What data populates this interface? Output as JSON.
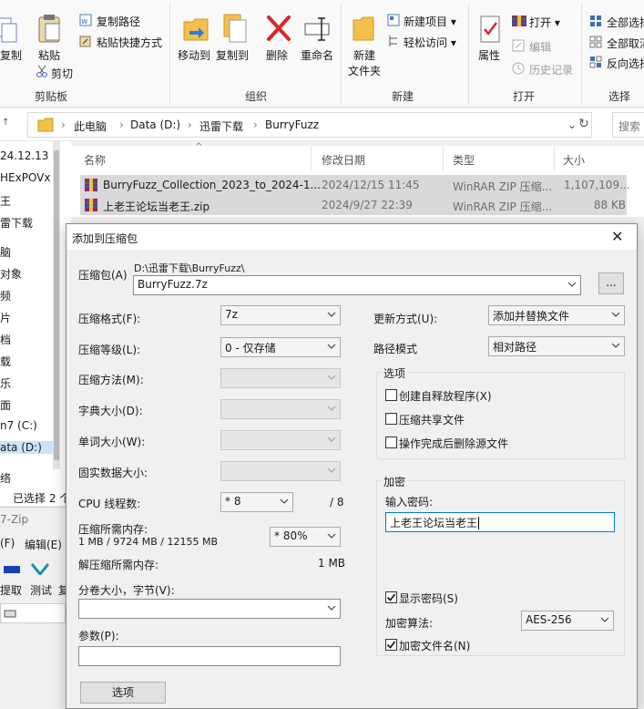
{
  "ribbon": {
    "clipboard": {
      "copy": "复制",
      "paste": "粘贴",
      "copy_path": "复制路径",
      "paste_shortcut": "粘贴快捷方式",
      "cut": "剪切",
      "group": "剪贴板"
    },
    "organize": {
      "move_to": "移动到",
      "copy_to": "复制到",
      "delete": "删除",
      "rename": "重命名",
      "group": "组织"
    },
    "new": {
      "new_folder_line1": "新建",
      "new_folder_line2": "文件夹",
      "new_item": "新建项目",
      "easy_access": "轻松访问",
      "group": "新建"
    },
    "open": {
      "properties": "属性",
      "open": "打开",
      "edit": "编辑",
      "history": "历史记录",
      "group": "打开"
    },
    "select": {
      "select_all": "全部选择",
      "select_none": "全部取消",
      "invert": "反向选择",
      "group": "选择"
    }
  },
  "address": {
    "crumbs": [
      "此电脑",
      "Data (D:)",
      "迅雷下载",
      "BurryFuzz"
    ],
    "search_placeholder": "搜索"
  },
  "columns": {
    "name": "名称",
    "date": "修改日期",
    "type": "类型",
    "size": "大小"
  },
  "files": [
    {
      "name": "BurryFuzz_Collection_2023_to_2024-1...",
      "date": "2024/12/15 11:45",
      "type": "WinRAR ZIP 压缩...",
      "size": "1,107,109..."
    },
    {
      "name": "上老王论坛当老王.zip",
      "date": "2024/9/27 22:39",
      "type": "WinRAR ZIP 压缩...",
      "size": "88 KB"
    }
  ],
  "nav_items": [
    "24.12.13",
    "HExPOVx",
    "王",
    "雷下载",
    "脑",
    "对象",
    "频",
    "片",
    "档",
    "载",
    "乐",
    "面",
    "n7 (C:)",
    "ata (D:)",
    "络"
  ],
  "status": {
    "selected": "已选择 2 个"
  },
  "sevenzip_bg": {
    "title": "7-Zip",
    "menu_file": "(F)",
    "menu_edit": "编辑(E)",
    "extract": "提取",
    "test": "测试",
    "copy": "复"
  },
  "dialog": {
    "title": "添加到压缩包",
    "archive_label": "压缩包(A)",
    "archive_path": "D:\\迅雷下载\\BurryFuzz\\",
    "archive_name": "BurryFuzz.7z",
    "browse": "...",
    "format_label": "压缩格式(F):",
    "format_value": "7z",
    "level_label": "压缩等级(L):",
    "level_value": "0 - 仅存储",
    "method_label": "压缩方法(M):",
    "dict_label": "字典大小(D):",
    "word_label": "单词大小(W):",
    "solid_label": "固实数据大小:",
    "threads_label": "CPU 线程数:",
    "threads_value": "8",
    "threads_max": "/ 8",
    "mem_label": "压缩所需内存:",
    "mem_detail": "1 MB / 9724 MB / 12155 MB",
    "mem_percent": "80%",
    "decomp_label": "解压缩所需内存:",
    "decomp_value": "1 MB",
    "split_label": "分卷大小，字节(V):",
    "params_label": "参数(P):",
    "options_button": "选项",
    "update_label": "更新方式(U):",
    "update_value": "添加并替换文件",
    "pathmode_label": "路径模式",
    "pathmode_value": "相对路径",
    "options_group": "选项",
    "opt_sfx": "创建自释放程序(X)",
    "opt_shared": "压缩共享文件",
    "opt_delete": "操作完成后删除源文件",
    "enc_group": "加密",
    "pwd_label": "输入密码:",
    "pwd_value": "上老王论坛当老王",
    "show_pwd": "显示密码(S)",
    "enc_method_label": "加密算法:",
    "enc_method_value": "AES-256",
    "enc_names": "加密文件名(N)"
  }
}
